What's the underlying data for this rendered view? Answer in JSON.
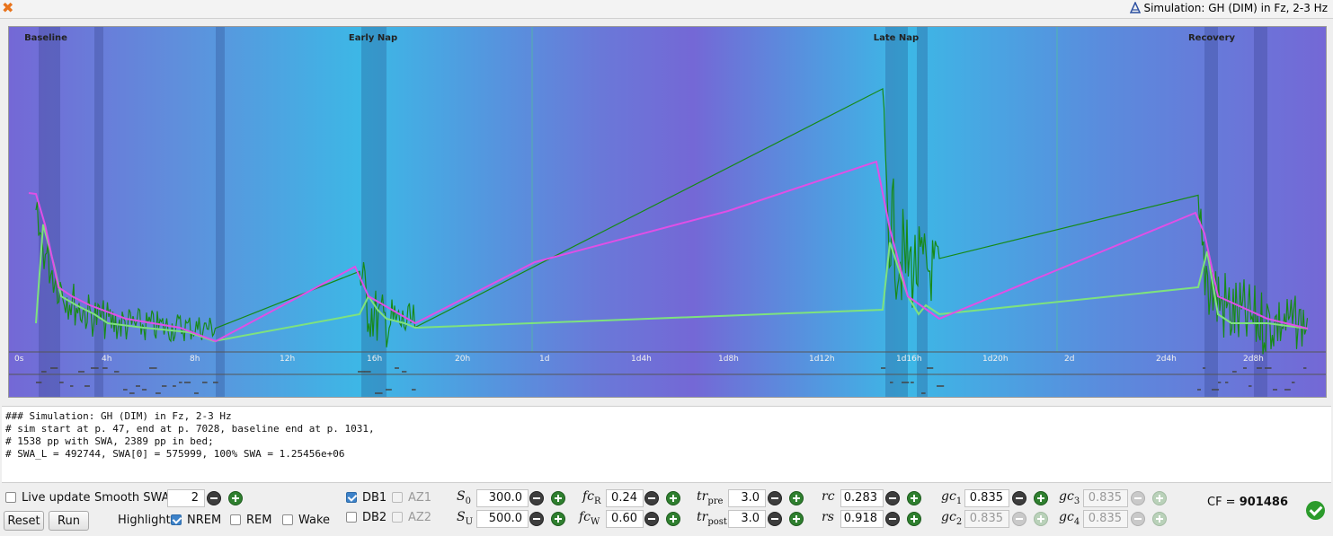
{
  "window": {
    "title": "Simulation: GH (DIM) in Fz, 2-3 Hz"
  },
  "plot": {
    "episodes": [
      "Baseline",
      "Early Nap",
      "Late Nap",
      "Recovery"
    ],
    "time_ticks": [
      "0s",
      "4h",
      "8h",
      "12h",
      "16h",
      "20h",
      "1d",
      "1d4h",
      "1d8h",
      "1d12h",
      "1d16h",
      "1d20h",
      "2d",
      "2d4h",
      "2d8h"
    ],
    "colors": {
      "background_dark": "#7468d6",
      "background_light": "#3cb8e6",
      "swa_raw": "#178a17",
      "swa_smoothed": "#7ee27e",
      "simulated": "#e04fe6"
    }
  },
  "notes": [
    "### Simulation: GH (DIM) in Fz, 2-3 Hz",
    "# sim start at p. 47, end at p. 7028, baseline end at p. 1031,",
    "# 1538 pp with SWA, 2389 pp in bed;",
    "# SWA_L = 492744, SWA[0] = 575999, 100% SWA = 1.25456e+06"
  ],
  "controls": {
    "live_update": {
      "label": "Live update",
      "checked": false
    },
    "smooth_swa": {
      "label": "Smooth SWA:",
      "value": "2"
    },
    "reset_label": "Reset",
    "run_label": "Run",
    "highlight": {
      "label": "Highlight:",
      "nrem": {
        "label": "NREM",
        "checked": true
      },
      "rem": {
        "label": "REM",
        "checked": false
      },
      "wake": {
        "label": "Wake",
        "checked": false
      }
    },
    "db1": {
      "label": "DB1",
      "checked": true
    },
    "db2": {
      "label": "DB2",
      "checked": false
    },
    "az1": {
      "label": "AZ1",
      "checked": false
    },
    "az2": {
      "label": "AZ2",
      "checked": false
    }
  },
  "params": {
    "s0": {
      "sym": "S",
      "sub": "0",
      "value": "300.0"
    },
    "su": {
      "sym": "S",
      "sub": "U",
      "value": "500.0"
    },
    "fcr": {
      "sym": "fc",
      "sub": "R",
      "value": "0.24"
    },
    "fcw": {
      "sym": "fc",
      "sub": "W",
      "value": "0.60"
    },
    "trpre": {
      "sym": "tr",
      "sub": "pre",
      "value": "3.0"
    },
    "trpost": {
      "sym": "tr",
      "sub": "post",
      "value": "3.0"
    },
    "rc": {
      "sym": "rc",
      "value": "0.283"
    },
    "rs": {
      "sym": "rs",
      "value": "0.918"
    },
    "gc1": {
      "sym": "gc",
      "sub": "1",
      "value": "0.835"
    },
    "gc2": {
      "sym": "gc",
      "sub": "2",
      "value": "0.835"
    },
    "gc3": {
      "sym": "gc",
      "sub": "3",
      "value": "0.835"
    },
    "gc4": {
      "sym": "gc",
      "sub": "4",
      "value": "0.835"
    }
  },
  "cost_function": {
    "label": "CF = ",
    "value": "901486"
  }
}
